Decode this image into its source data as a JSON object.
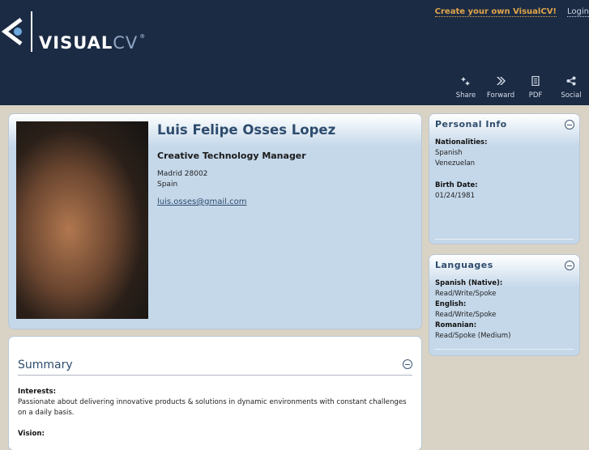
{
  "header": {
    "logo": {
      "word": "VISUAL",
      "suffix": "CV",
      "registered": "®"
    },
    "create_link": "Create your own VisualCV!",
    "login_link": "Login"
  },
  "toolbar": [
    {
      "label": "Share",
      "icon": "share-sparkle-icon"
    },
    {
      "label": "Forward",
      "icon": "forward-icon"
    },
    {
      "label": "PDF",
      "icon": "document-icon"
    },
    {
      "label": "Social",
      "icon": "social-share-icon"
    }
  ],
  "profile": {
    "name": "Luis Felipe Osses Lopez",
    "role": "Creative Technology Manager",
    "address_line1": "Madrid 28002",
    "address_line2": "Spain",
    "email": "luis.osses@gmail.com"
  },
  "personal_info": {
    "title": "Personal Info",
    "nationalities_label": "Nationalities:",
    "nationalities": [
      "Spanish",
      "Venezuelan"
    ],
    "birth_label": "Birth Date:",
    "birth_date": "01/24/1981"
  },
  "languages": {
    "title": "Languages",
    "items": [
      {
        "name": "Spanish (Native):",
        "level": "Read/Write/Spoke"
      },
      {
        "name": "English:",
        "level": "Read/Write/Spoke"
      },
      {
        "name": "Romanian:",
        "level": "Read/Spoke (Medium)"
      }
    ]
  },
  "summary": {
    "title": "Summary",
    "interests_label": "Interests:",
    "interests_text": "Passionate about delivering innovative products & solutions in dynamic environments with constant challenges on a daily basis.",
    "vision_label": "Vision:"
  },
  "colors": {
    "header_bg": "#1b2b44",
    "page_bg": "#d9d3c5",
    "panel_bg": "#c5d8ea",
    "accent_link": "#e1a54a",
    "title_blue": "#2e4c6e"
  }
}
